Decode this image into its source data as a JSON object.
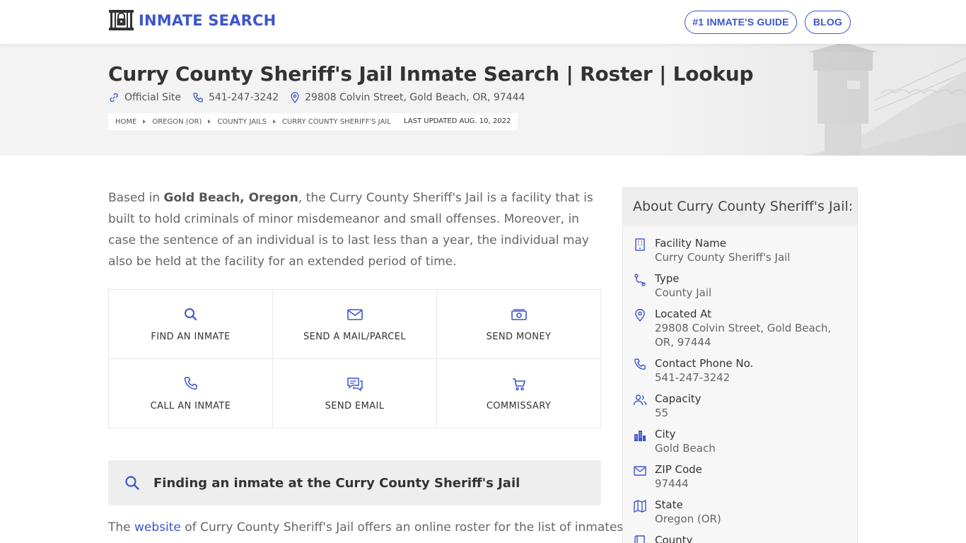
{
  "header": {
    "brand": "INMATE SEARCH",
    "nav": {
      "guide": "#1 INMATE'S GUIDE",
      "blog": "BLOG"
    }
  },
  "hero": {
    "title": "Curry County Sheriff's Jail Inmate Search | Roster | Lookup",
    "official_site": "Official Site",
    "phone": "541-247-3242",
    "address": "29808 Colvin Street, Gold Beach, OR, 97444",
    "breadcrumbs": [
      "HOME",
      "OREGON (OR)",
      "COUNTY JAILS",
      "CURRY COUNTY SHERIFF'S JAIL"
    ],
    "last_updated": "LAST UPDATED AUG. 10, 2022"
  },
  "intro": {
    "pre": "Based in ",
    "bold": "Gold Beach, Oregon",
    "post": ", the Curry County Sheriff's Jail is a facility that is built to hold criminals of minor misdemeanor and small offenses. Moreover, in case the sentence of an individual is to last less than a year, the individual may also be held at the facility for an extended period of time."
  },
  "actions": [
    {
      "label": "FIND AN INMATE",
      "icon": "search-icon"
    },
    {
      "label": "SEND A MAIL/PARCEL",
      "icon": "mail-icon"
    },
    {
      "label": "SEND MONEY",
      "icon": "money-icon"
    },
    {
      "label": "CALL AN INMATE",
      "icon": "phone-icon"
    },
    {
      "label": "SEND EMAIL",
      "icon": "chat-icon"
    },
    {
      "label": "COMMISSARY",
      "icon": "cart-icon"
    }
  ],
  "finding": {
    "title": "Finding an inmate at the Curry County Sheriff's Jail",
    "para_pre": "The ",
    "para_link": "website",
    "para_post": " of Curry County Sheriff's Jail offers an online roster for the list of inmates"
  },
  "sidebar": {
    "title": "About Curry County Sheriff's Jail:",
    "items": [
      {
        "label": "Facility Name",
        "value": "Curry County Sheriff's Jail",
        "icon": "building-icon"
      },
      {
        "label": "Type",
        "value": "County Jail",
        "icon": "route-icon"
      },
      {
        "label": "Located At",
        "value": "29808 Colvin Street, Gold Beach, OR, 97444",
        "icon": "map-pin-icon"
      },
      {
        "label": "Contact Phone No.",
        "value": "541-247-3242",
        "icon": "phone-icon"
      },
      {
        "label": "Capacity",
        "value": "55",
        "icon": "users-icon"
      },
      {
        "label": "City",
        "value": "Gold Beach",
        "icon": "city-icon"
      },
      {
        "label": "ZIP Code",
        "value": "97444",
        "icon": "envelope-icon"
      },
      {
        "label": "State",
        "value": "Oregon (OR)",
        "icon": "map-icon"
      },
      {
        "label": "County",
        "value": "",
        "icon": "book-icon"
      }
    ]
  },
  "colors": {
    "accent": "#3c55cc",
    "text": "#333333",
    "muted": "#666666",
    "panel": "#f7f7f7"
  }
}
